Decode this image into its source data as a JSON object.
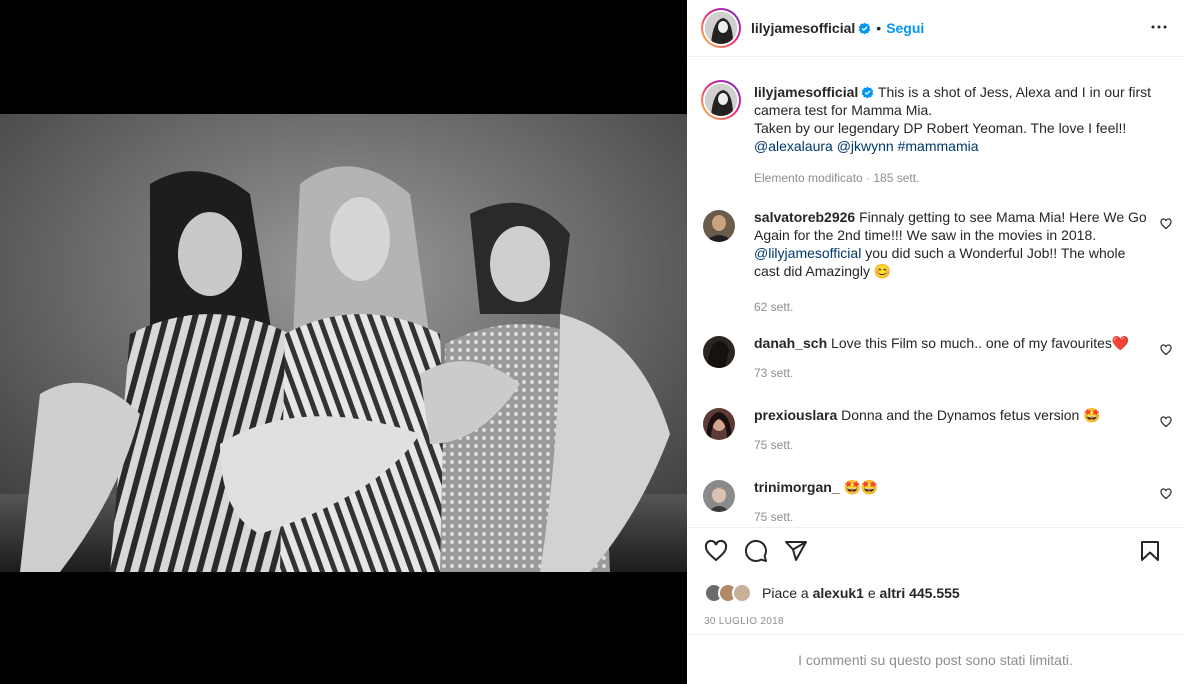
{
  "post": {
    "username": "lilyjamesofficial",
    "follow_label": "Segui",
    "dot": "•",
    "caption_text": "This is a shot of Jess, Alexa and I in our first camera test for Mamma Mia.",
    "caption_line2": "Taken by our legendary DP Robert Yeoman. The love I feel!!",
    "caption_tags": [
      "@alexalaura",
      "@jkwynn",
      "#mammamia"
    ],
    "caption_meta": "Elemento modificato · 185 sett."
  },
  "comments": [
    {
      "username": "salvatoreb2926",
      "text_before": "Finnaly getting to see Mama Mia! Here We Go Again for the 2nd time!!! We saw in the movies in 2018.",
      "mention": "@lilyjamesofficial",
      "text_after": "you did such a Wonderful Job!! The whole cast did Amazingly",
      "emoji": "😊",
      "time": "62 sett."
    },
    {
      "username": "danah_sch",
      "text_before": "Love this Film so much.. one of my favourites",
      "emoji": "❤️",
      "time": "73 sett."
    },
    {
      "username": "prexiouslara",
      "text_before": "Donna and the Dynamos fetus version",
      "emoji": "🤩",
      "time": "75 sett."
    },
    {
      "username": "trinimorgan_",
      "text_before": "",
      "emoji": "🤩🤩",
      "time": "75 sett."
    }
  ],
  "likes": {
    "prefix": "Piace a",
    "user": "alexuk1",
    "joiner": "e",
    "others": "altri 445.555"
  },
  "date": "30 luglio 2018",
  "comments_limited": "I commenti su questo post sono stati limitati.",
  "icons": {
    "like": "heart-icon",
    "comment": "comment-icon",
    "share": "paper-plane-icon",
    "save": "bookmark-icon",
    "more": "more-dots-icon",
    "verified": "verified-badge-icon"
  },
  "colors": {
    "link": "#0095f6",
    "mention": "#00376b",
    "muted": "#8e8e8e",
    "text": "#262626"
  }
}
